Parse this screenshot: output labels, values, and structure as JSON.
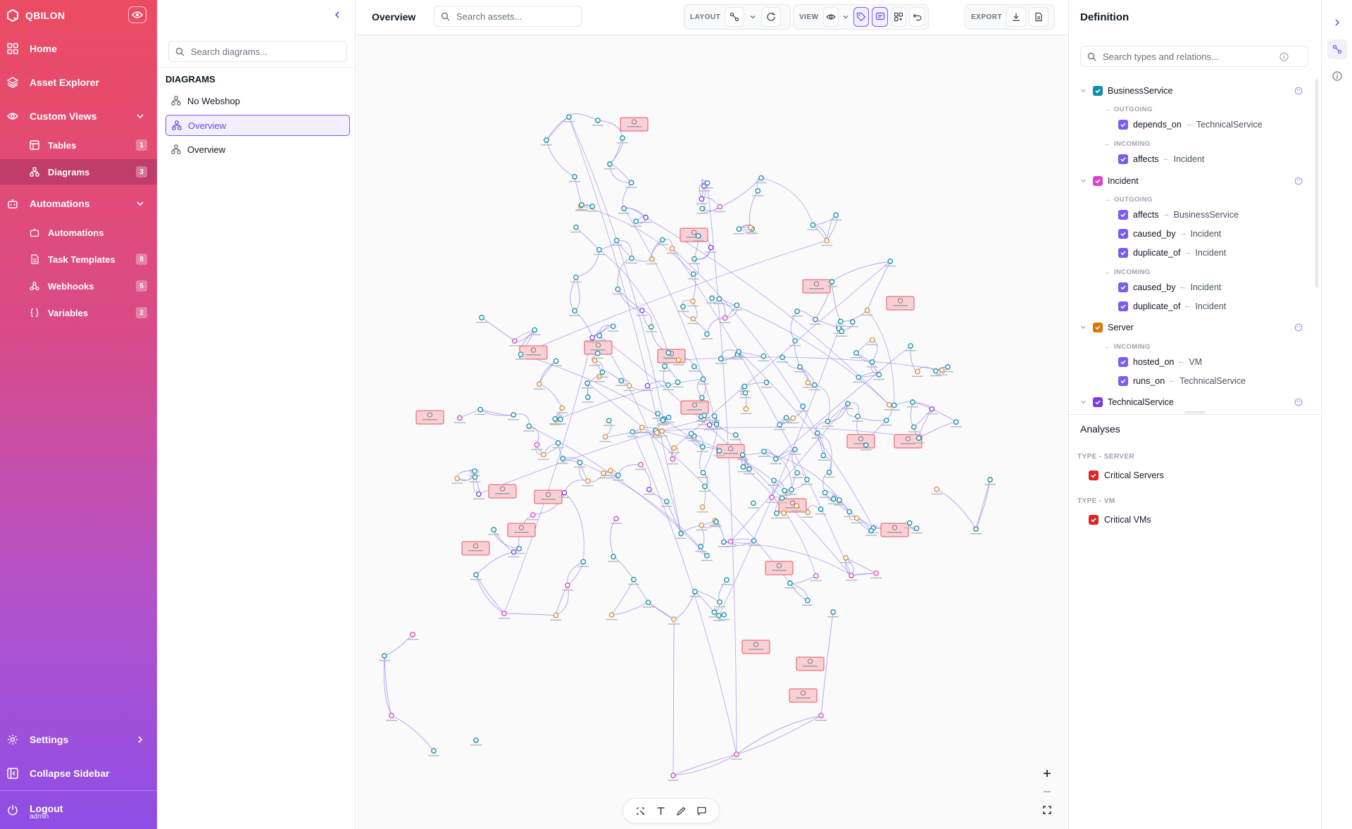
{
  "app": {
    "brand": "QBILON"
  },
  "sidebar": {
    "home": "Home",
    "asset_explorer": "Asset Explorer",
    "custom_views": "Custom Views",
    "tables": "Tables",
    "tables_count": "1",
    "diagrams": "Diagrams",
    "diagrams_count": "3",
    "automations_section": "Automations",
    "automations": "Automations",
    "task_templates": "Task Templates",
    "task_templates_count": "8",
    "webhooks": "Webhooks",
    "webhooks_count": "5",
    "variables": "Variables",
    "variables_count": "2",
    "settings": "Settings",
    "collapse": "Collapse Sidebar",
    "logout": "Logout",
    "user": "admin"
  },
  "diagrams_panel": {
    "search_placeholder": "Search diagrams...",
    "section_title": "DIAGRAMS",
    "items": [
      "No Webshop",
      "Overview",
      "Overview"
    ]
  },
  "toolbar": {
    "title": "Overview",
    "search_placeholder": "Search assets...",
    "layout_label": "LAYOUT",
    "view_label": "VIEW",
    "export_label": "EXPORT"
  },
  "definition": {
    "title": "Definition",
    "search_placeholder": "Search types and relations...",
    "outgoing": "OUTGOING",
    "incoming": "INCOMING",
    "types": [
      {
        "name": "BusinessService",
        "color": "#0e8fa8"
      },
      {
        "name": "Incident",
        "color": "#d946c9"
      },
      {
        "name": "Server",
        "color": "#d97706"
      },
      {
        "name": "TechnicalService",
        "color": "#7c3aed"
      }
    ],
    "relations": {
      "bs_out_1": {
        "name": "depends_on",
        "target": "TechnicalService"
      },
      "bs_in_1": {
        "name": "affects",
        "target": "Incident"
      },
      "inc_out_1": {
        "name": "affects",
        "target": "BusinessService"
      },
      "inc_out_2": {
        "name": "caused_by",
        "target": "Incident"
      },
      "inc_out_3": {
        "name": "duplicate_of",
        "target": "Incident"
      },
      "inc_in_1": {
        "name": "caused_by",
        "target": "Incident"
      },
      "inc_in_2": {
        "name": "duplicate_of",
        "target": "Incident"
      },
      "srv_in_1": {
        "name": "hosted_on",
        "target": "VM"
      },
      "srv_in_2": {
        "name": "runs_on",
        "target": "TechnicalService"
      }
    },
    "relation_color": "#7c5cf0"
  },
  "analyses": {
    "title": "Analyses",
    "groups": [
      {
        "label": "TYPE - SERVER",
        "item": "Critical Servers"
      },
      {
        "label": "TYPE - VM",
        "item": "Critical VMs"
      }
    ],
    "check_color": "#dc2626"
  },
  "graph_colors": {
    "edge": "#8b7cf0",
    "teal_node": "#0e8fa8",
    "orange_node": "#e2892b",
    "pink_node": "#d946c9",
    "purple_node": "#7c3aed",
    "highlight_fill": "#fbd0d4",
    "highlight_stroke": "#e25563"
  }
}
